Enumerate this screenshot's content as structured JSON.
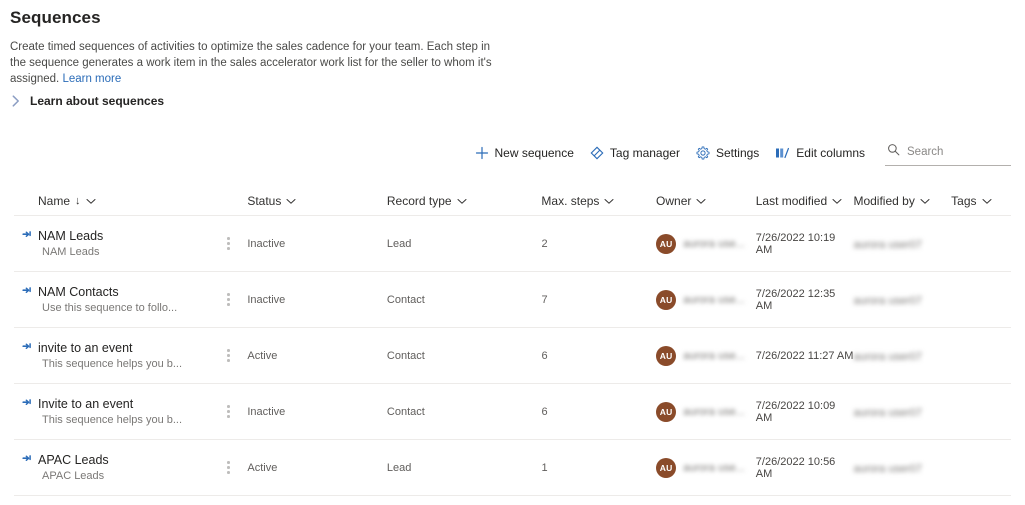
{
  "header": {
    "title": "Sequences",
    "description_line1": "Create timed sequences of activities to optimize the sales cadence for your team. Each step in the sequence",
    "description_line2": "generates a work item in the sales accelerator work list for the seller to whom it's assigned.",
    "learn_more_label": "Learn more"
  },
  "expander": {
    "label": "Learn about sequences",
    "icon": "chevron-right-icon",
    "expanded": false
  },
  "toolbar": {
    "new_sequence_label": "New sequence",
    "tag_manager_label": "Tag manager",
    "settings_label": "Settings",
    "edit_columns_label": "Edit columns",
    "icons": {
      "new_sequence": "plus-icon",
      "tag_manager": "tag-icon",
      "settings": "gear-icon",
      "edit_columns": "columns-icon",
      "search": "search-icon"
    }
  },
  "search": {
    "value": "",
    "placeholder": "Search"
  },
  "table": {
    "columns": [
      {
        "label": "Name",
        "sorted": true,
        "sort_direction": "↓"
      },
      {
        "label": "Status",
        "sorted": false
      },
      {
        "label": "Record type",
        "sorted": false
      },
      {
        "label": "Max. steps",
        "sorted": false
      },
      {
        "label": "Owner",
        "sorted": false
      },
      {
        "label": "Last modified",
        "sorted": false
      },
      {
        "label": "Modified by",
        "sorted": false
      },
      {
        "label": "Tags",
        "sorted": false
      }
    ],
    "rows": [
      {
        "name": "NAM Leads",
        "subtitle": "NAM Leads",
        "status": "Inactive",
        "record_type": "Lead",
        "max_steps": "2",
        "owner": "aurora use...",
        "owner_initials": "AU",
        "last_modified": "7/26/2022 10:19 AM",
        "modified_by": "aurora user07",
        "tags": ""
      },
      {
        "name": "NAM Contacts",
        "subtitle": "Use this sequence to follo...",
        "status": "Inactive",
        "record_type": "Contact",
        "max_steps": "7",
        "owner": "aurora use...",
        "owner_initials": "AU",
        "last_modified": "7/26/2022 12:35 AM",
        "modified_by": "aurora user07",
        "tags": ""
      },
      {
        "name": "invite to an event",
        "subtitle": "This sequence helps you b...",
        "status": "Active",
        "record_type": "Contact",
        "max_steps": "6",
        "owner": "aurora use...",
        "owner_initials": "AU",
        "last_modified": "7/26/2022 11:27 AM",
        "modified_by": "aurora user07",
        "tags": ""
      },
      {
        "name": "Invite to an event",
        "subtitle": "This sequence helps you b...",
        "status": "Inactive",
        "record_type": "Contact",
        "max_steps": "6",
        "owner": "aurora use...",
        "owner_initials": "AU",
        "last_modified": "7/26/2022 10:09 AM",
        "modified_by": "aurora user07",
        "tags": ""
      },
      {
        "name": "APAC Leads",
        "subtitle": "APAC Leads",
        "status": "Active",
        "record_type": "Lead",
        "max_steps": "1",
        "owner": "aurora use...",
        "owner_initials": "AU",
        "last_modified": "7/26/2022 10:56 AM",
        "modified_by": "aurora user07",
        "tags": ""
      }
    ],
    "row_menu_icon": "more-vertical-icon",
    "row_icon": "sequence-icon"
  },
  "colors": {
    "accent": "#0f6cbd",
    "link": "#2b6cb8",
    "avatar": "#8a4b2a",
    "row_border": "#edebe9",
    "text_primary": "#252423",
    "text_secondary": "#605e5c"
  }
}
